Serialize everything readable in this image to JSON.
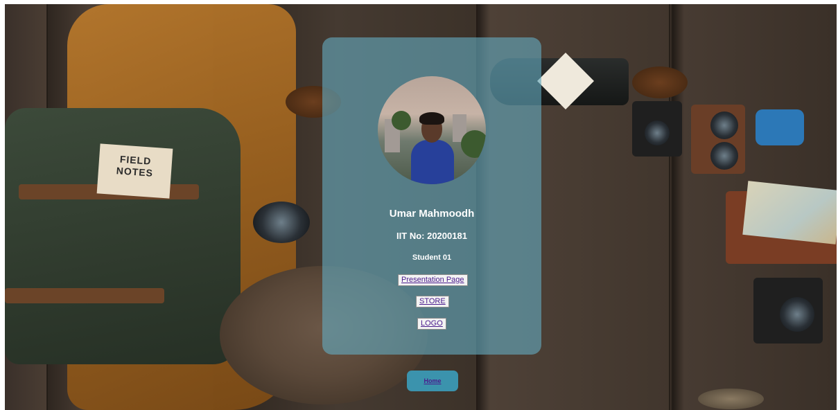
{
  "profile": {
    "name": "Umar Mahmoodh",
    "iit_number": "IIT No: 20200181",
    "role": "Student 01"
  },
  "links": {
    "presentation": "Presentation Page",
    "store": "STORE",
    "logo": "LOGO"
  },
  "footer": {
    "home": "Home"
  },
  "background": {
    "notes_text": "FIELD NOTES"
  },
  "colors": {
    "card": "#64aabe",
    "home_button": "#3b93ad",
    "link_text": "#4a1a8c"
  }
}
